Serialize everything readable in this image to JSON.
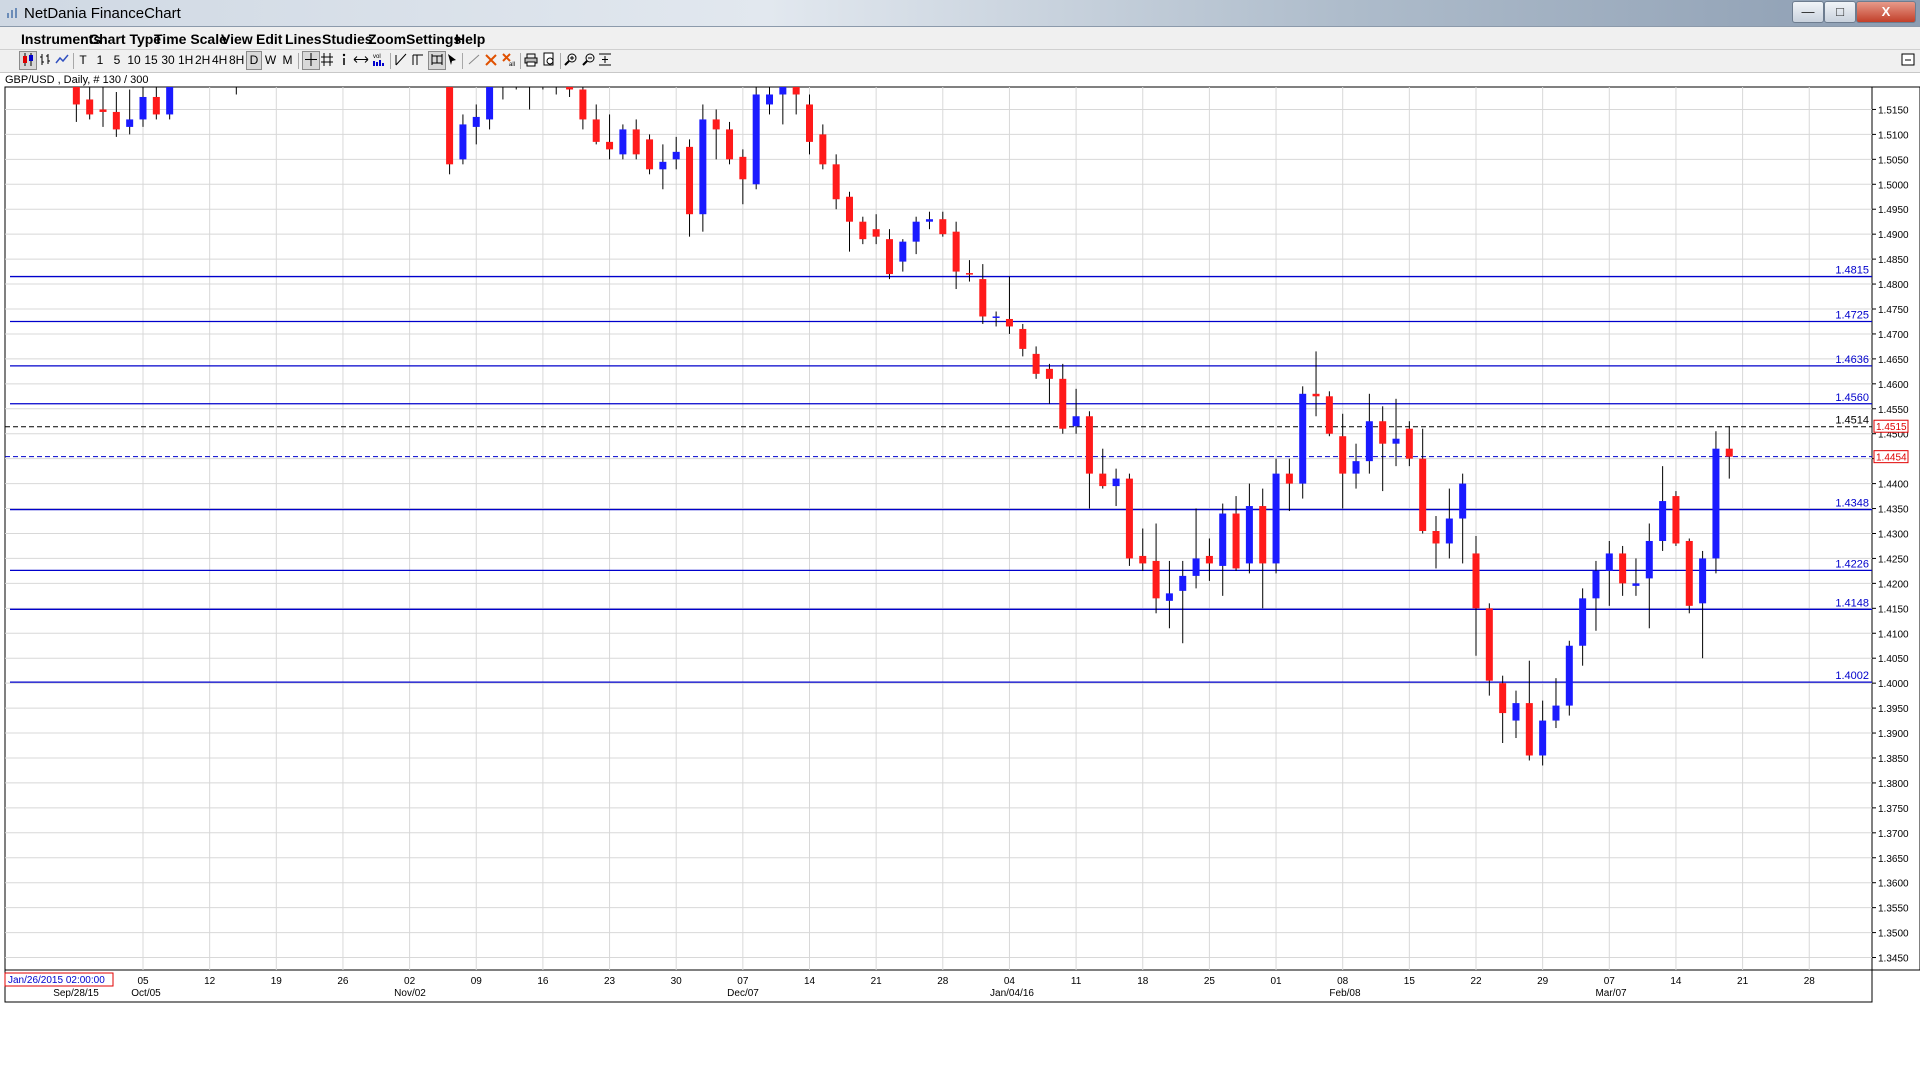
{
  "window": {
    "title": "NetDania FinanceChart",
    "minimize_glyph": "—",
    "maximize_glyph": "□",
    "close_glyph": "X"
  },
  "menu": [
    "Instruments",
    "Chart Type",
    "Time Scale",
    "View",
    "Edit",
    "Lines",
    "Studies",
    "Zoom",
    "Settings",
    "Help"
  ],
  "toolbar": {
    "timeframes": [
      "T",
      "1",
      "5",
      "10",
      "15",
      "30",
      "1H",
      "2H",
      "4H",
      "8H",
      "D",
      "W",
      "M"
    ],
    "selected_timeframe": "D",
    "icons": [
      "candlestick-icon",
      "bars-icon",
      "line-icon",
      "crosshair-icon",
      "grid-icon",
      "info-icon",
      "pan-icon",
      "volume-icon",
      "trendline-icon",
      "fibonacci-icon",
      "channel-icon",
      "cursor-icon",
      "draw-line-icon",
      "delete-icon",
      "delete-all-icon",
      "print-icon",
      "print-preview-icon",
      "zoom-in-icon",
      "zoom-out-icon",
      "fit-icon"
    ]
  },
  "instrument_label": "GBP/USD , Daily, # 130 / 300",
  "chart_data": {
    "type": "candlestick",
    "instrument": "GBP/USD",
    "period": "Daily",
    "y_axis": {
      "side": "right",
      "range": [
        1.3425,
        1.5195
      ],
      "ticks": [
        "1.5150",
        "1.5100",
        "1.5050",
        "1.5000",
        "1.4950",
        "1.4900",
        "1.4850",
        "1.4800",
        "1.4750",
        "1.4700",
        "1.4650",
        "1.4600",
        "1.4550",
        "1.4500",
        "1.4450",
        "1.4400",
        "1.4350",
        "1.4300",
        "1.4250",
        "1.4200",
        "1.4150",
        "1.4100",
        "1.4050",
        "1.4000",
        "1.3950",
        "1.3900",
        "1.3850",
        "1.3800",
        "1.3750",
        "1.3700",
        "1.3650",
        "1.3600",
        "1.3550",
        "1.3500",
        "1.3450"
      ]
    },
    "x_axis": {
      "day_labels": [
        "05",
        "12",
        "19",
        "26",
        "02",
        "09",
        "16",
        "23",
        "30",
        "07",
        "14",
        "21",
        "28",
        "04",
        "11",
        "18",
        "25",
        "01",
        "08",
        "15",
        "22",
        "29",
        "07",
        "14",
        "21",
        "28"
      ],
      "period_labels": [
        "Sep/28/15",
        "Oct/05",
        "Nov/02",
        "Dec/07",
        "Jan/04/16",
        "Feb/08",
        "Mar/07"
      ],
      "cursor_date_label": "Jan/26/2015 02:00:00"
    },
    "horizontal_lines": [
      {
        "value": 1.4815,
        "label": "1.4815"
      },
      {
        "value": 1.4725,
        "label": "1.4725"
      },
      {
        "value": 1.4636,
        "label": "1.4636"
      },
      {
        "value": 1.456,
        "label": "1.4560"
      },
      {
        "value": 1.4348,
        "label": "1.4348"
      },
      {
        "value": 1.4226,
        "label": "1.4226"
      },
      {
        "value": 1.4148,
        "label": "1.4148"
      },
      {
        "value": 1.4002,
        "label": "1.4002"
      }
    ],
    "dashed_lines": [
      {
        "value": 1.4514,
        "label": "1.4514",
        "color": "#000000"
      },
      {
        "value": 1.4454,
        "label": "",
        "color": "#0000cc"
      }
    ],
    "price_tags": [
      {
        "value": 1.4515,
        "label": "1.4515",
        "color": "#e00000"
      },
      {
        "value": 1.4454,
        "label": "1.4454",
        "color": "#e00000"
      }
    ],
    "colors": {
      "up": "#1a1aff",
      "down": "#ff1a1a",
      "wick": "#000000",
      "hline": "#0000cc",
      "grid": "#d8d8d8"
    },
    "candles": [
      {
        "date": "2015-09-28",
        "o": 1.522,
        "h": 1.524,
        "l": 1.5125,
        "c": 1.516
      },
      {
        "date": "2015-09-29",
        "o": 1.517,
        "h": 1.5215,
        "l": 1.513,
        "c": 1.514
      },
      {
        "date": "2015-09-30",
        "o": 1.515,
        "h": 1.52,
        "l": 1.5115,
        "c": 1.5145
      },
      {
        "date": "2015-10-01",
        "o": 1.5145,
        "h": 1.5185,
        "l": 1.5095,
        "c": 1.511
      },
      {
        "date": "2015-10-02",
        "o": 1.5115,
        "h": 1.519,
        "l": 1.51,
        "c": 1.513
      },
      {
        "date": "2015-10-05",
        "o": 1.513,
        "h": 1.5225,
        "l": 1.5115,
        "c": 1.5175
      },
      {
        "date": "2015-10-06",
        "o": 1.5175,
        "h": 1.5215,
        "l": 1.513,
        "c": 1.514
      },
      {
        "date": "2015-10-07",
        "o": 1.514,
        "h": 1.525,
        "l": 1.513,
        "c": 1.524
      },
      {
        "date": "2015-10-14",
        "o": 1.525,
        "h": 1.528,
        "l": 1.518,
        "c": 1.526
      },
      {
        "date": "2015-11-04",
        "o": 1.525,
        "h": 1.529,
        "l": 1.52,
        "c": 1.521
      },
      {
        "date": "2015-11-05",
        "o": 1.521,
        "h": 1.523,
        "l": 1.502,
        "c": 1.504
      },
      {
        "date": "2015-11-06",
        "o": 1.505,
        "h": 1.514,
        "l": 1.504,
        "c": 1.512
      },
      {
        "date": "2015-11-09",
        "o": 1.5115,
        "h": 1.516,
        "l": 1.508,
        "c": 1.5135
      },
      {
        "date": "2015-11-10",
        "o": 1.513,
        "h": 1.523,
        "l": 1.511,
        "c": 1.521
      },
      {
        "date": "2015-11-11",
        "o": 1.521,
        "h": 1.5255,
        "l": 1.517,
        "c": 1.5225
      },
      {
        "date": "2015-11-12",
        "o": 1.5225,
        "h": 1.527,
        "l": 1.519,
        "c": 1.524
      },
      {
        "date": "2015-11-13",
        "o": 1.524,
        "h": 1.525,
        "l": 1.515,
        "c": 1.5225
      },
      {
        "date": "2015-11-16",
        "o": 1.5225,
        "h": 1.524,
        "l": 1.519,
        "c": 1.521
      },
      {
        "date": "2015-11-17",
        "o": 1.521,
        "h": 1.5245,
        "l": 1.518,
        "c": 1.523
      },
      {
        "date": "2015-11-18",
        "o": 1.523,
        "h": 1.527,
        "l": 1.5175,
        "c": 1.519
      },
      {
        "date": "2015-11-19",
        "o": 1.519,
        "h": 1.522,
        "l": 1.511,
        "c": 1.513
      },
      {
        "date": "2015-11-20",
        "o": 1.513,
        "h": 1.516,
        "l": 1.508,
        "c": 1.5085
      },
      {
        "date": "2015-11-23",
        "o": 1.5085,
        "h": 1.514,
        "l": 1.505,
        "c": 1.507
      },
      {
        "date": "2015-11-24",
        "o": 1.506,
        "h": 1.512,
        "l": 1.505,
        "c": 1.511
      },
      {
        "date": "2015-11-25",
        "o": 1.511,
        "h": 1.513,
        "l": 1.505,
        "c": 1.506
      },
      {
        "date": "2015-11-26",
        "o": 1.509,
        "h": 1.51,
        "l": 1.502,
        "c": 1.503
      },
      {
        "date": "2015-11-27",
        "o": 1.503,
        "h": 1.508,
        "l": 1.499,
        "c": 1.5045
      },
      {
        "date": "2015-11-30",
        "o": 1.505,
        "h": 1.5095,
        "l": 1.503,
        "c": 1.5065
      },
      {
        "date": "2015-12-01",
        "o": 1.5075,
        "h": 1.509,
        "l": 1.4895,
        "c": 1.494
      },
      {
        "date": "2015-12-02",
        "o": 1.494,
        "h": 1.516,
        "l": 1.4905,
        "c": 1.513
      },
      {
        "date": "2015-12-03",
        "o": 1.513,
        "h": 1.515,
        "l": 1.505,
        "c": 1.511
      },
      {
        "date": "2015-12-04",
        "o": 1.511,
        "h": 1.5125,
        "l": 1.504,
        "c": 1.505
      },
      {
        "date": "2015-12-07",
        "o": 1.5055,
        "h": 1.507,
        "l": 1.496,
        "c": 1.501
      },
      {
        "date": "2015-12-08",
        "o": 1.5,
        "h": 1.52,
        "l": 1.499,
        "c": 1.518
      },
      {
        "date": "2015-12-09",
        "o": 1.516,
        "h": 1.522,
        "l": 1.514,
        "c": 1.518
      },
      {
        "date": "2015-12-10",
        "o": 1.518,
        "h": 1.523,
        "l": 1.512,
        "c": 1.522
      },
      {
        "date": "2015-12-11",
        "o": 1.521,
        "h": 1.5225,
        "l": 1.514,
        "c": 1.518
      },
      {
        "date": "2015-12-14",
        "o": 1.516,
        "h": 1.518,
        "l": 1.506,
        "c": 1.5085
      },
      {
        "date": "2015-12-15",
        "o": 1.51,
        "h": 1.512,
        "l": 1.503,
        "c": 1.504
      },
      {
        "date": "2015-12-16",
        "o": 1.504,
        "h": 1.506,
        "l": 1.495,
        "c": 1.497
      },
      {
        "date": "2015-12-17",
        "o": 1.4975,
        "h": 1.4985,
        "l": 1.4865,
        "c": 1.4925
      },
      {
        "date": "2015-12-18",
        "o": 1.4925,
        "h": 1.4935,
        "l": 1.488,
        "c": 1.489
      },
      {
        "date": "2015-12-21",
        "o": 1.491,
        "h": 1.494,
        "l": 1.488,
        "c": 1.4895
      },
      {
        "date": "2015-12-22",
        "o": 1.489,
        "h": 1.491,
        "l": 1.481,
        "c": 1.482
      },
      {
        "date": "2015-12-23",
        "o": 1.4845,
        "h": 1.489,
        "l": 1.4825,
        "c": 1.4885
      },
      {
        "date": "2015-12-24",
        "o": 1.4885,
        "h": 1.4935,
        "l": 1.486,
        "c": 1.4925
      },
      {
        "date": "2015-12-25",
        "o": 1.4925,
        "h": 1.4945,
        "l": 1.491,
        "c": 1.493
      },
      {
        "date": "2015-12-28",
        "o": 1.493,
        "h": 1.4945,
        "l": 1.4895,
        "c": 1.49
      },
      {
        "date": "2015-12-29",
        "o": 1.4905,
        "h": 1.4925,
        "l": 1.479,
        "c": 1.4825
      },
      {
        "date": "2015-12-30",
        "o": 1.4822,
        "h": 1.4848,
        "l": 1.4805,
        "c": 1.482
      },
      {
        "date": "2015-12-31",
        "o": 1.481,
        "h": 1.484,
        "l": 1.472,
        "c": 1.4735
      },
      {
        "date": "2016-01-01",
        "o": 1.4735,
        "h": 1.4745,
        "l": 1.4715,
        "c": 1.4735
      },
      {
        "date": "2016-01-04",
        "o": 1.473,
        "h": 1.4815,
        "l": 1.47,
        "c": 1.4715
      },
      {
        "date": "2016-01-05",
        "o": 1.471,
        "h": 1.472,
        "l": 1.4655,
        "c": 1.467
      },
      {
        "date": "2016-01-06",
        "o": 1.466,
        "h": 1.4675,
        "l": 1.461,
        "c": 1.462
      },
      {
        "date": "2016-01-07",
        "o": 1.463,
        "h": 1.464,
        "l": 1.456,
        "c": 1.461
      },
      {
        "date": "2016-01-08",
        "o": 1.461,
        "h": 1.464,
        "l": 1.45,
        "c": 1.451
      },
      {
        "date": "2016-01-11",
        "o": 1.4515,
        "h": 1.459,
        "l": 1.45,
        "c": 1.4535
      },
      {
        "date": "2016-01-12",
        "o": 1.4535,
        "h": 1.4545,
        "l": 1.435,
        "c": 1.442
      },
      {
        "date": "2016-01-13",
        "o": 1.442,
        "h": 1.447,
        "l": 1.439,
        "c": 1.4395
      },
      {
        "date": "2016-01-14",
        "o": 1.4395,
        "h": 1.443,
        "l": 1.4355,
        "c": 1.441
      },
      {
        "date": "2016-01-15",
        "o": 1.441,
        "h": 1.442,
        "l": 1.4235,
        "c": 1.425
      },
      {
        "date": "2016-01-18",
        "o": 1.4255,
        "h": 1.431,
        "l": 1.4225,
        "c": 1.424
      },
      {
        "date": "2016-01-19",
        "o": 1.4245,
        "h": 1.432,
        "l": 1.414,
        "c": 1.417
      },
      {
        "date": "2016-01-20",
        "o": 1.4165,
        "h": 1.4245,
        "l": 1.411,
        "c": 1.418
      },
      {
        "date": "2016-01-21",
        "o": 1.4185,
        "h": 1.4245,
        "l": 1.408,
        "c": 1.4215
      },
      {
        "date": "2016-01-22",
        "o": 1.4215,
        "h": 1.435,
        "l": 1.419,
        "c": 1.425
      },
      {
        "date": "2016-01-25",
        "o": 1.4255,
        "h": 1.429,
        "l": 1.4205,
        "c": 1.424
      },
      {
        "date": "2016-01-26",
        "o": 1.4235,
        "h": 1.436,
        "l": 1.4175,
        "c": 1.434
      },
      {
        "date": "2016-01-27",
        "o": 1.434,
        "h": 1.4375,
        "l": 1.4225,
        "c": 1.423
      },
      {
        "date": "2016-01-28",
        "o": 1.424,
        "h": 1.44,
        "l": 1.422,
        "c": 1.4355
      },
      {
        "date": "2016-01-29",
        "o": 1.4355,
        "h": 1.439,
        "l": 1.415,
        "c": 1.424
      },
      {
        "date": "2016-02-01",
        "o": 1.424,
        "h": 1.445,
        "l": 1.422,
        "c": 1.442
      },
      {
        "date": "2016-02-02",
        "o": 1.442,
        "h": 1.445,
        "l": 1.4345,
        "c": 1.44
      },
      {
        "date": "2016-02-03",
        "o": 1.44,
        "h": 1.4595,
        "l": 1.437,
        "c": 1.458
      },
      {
        "date": "2016-02-04",
        "o": 1.458,
        "h": 1.4665,
        "l": 1.4535,
        "c": 1.4575
      },
      {
        "date": "2016-02-05",
        "o": 1.4575,
        "h": 1.4585,
        "l": 1.4495,
        "c": 1.45
      },
      {
        "date": "2016-02-08",
        "o": 1.4495,
        "h": 1.454,
        "l": 1.435,
        "c": 1.442
      },
      {
        "date": "2016-02-09",
        "o": 1.442,
        "h": 1.448,
        "l": 1.439,
        "c": 1.4445
      },
      {
        "date": "2016-02-10",
        "o": 1.4445,
        "h": 1.458,
        "l": 1.442,
        "c": 1.4525
      },
      {
        "date": "2016-02-11",
        "o": 1.4525,
        "h": 1.4555,
        "l": 1.4385,
        "c": 1.448
      },
      {
        "date": "2016-02-12",
        "o": 1.448,
        "h": 1.457,
        "l": 1.4435,
        "c": 1.449
      },
      {
        "date": "2016-02-15",
        "o": 1.451,
        "h": 1.4525,
        "l": 1.4435,
        "c": 1.445
      },
      {
        "date": "2016-02-16",
        "o": 1.445,
        "h": 1.451,
        "l": 1.43,
        "c": 1.4305
      },
      {
        "date": "2016-02-17",
        "o": 1.4305,
        "h": 1.4335,
        "l": 1.423,
        "c": 1.428
      },
      {
        "date": "2016-02-18",
        "o": 1.428,
        "h": 1.439,
        "l": 1.425,
        "c": 1.433
      },
      {
        "date": "2016-02-19",
        "o": 1.433,
        "h": 1.442,
        "l": 1.424,
        "c": 1.44
      },
      {
        "date": "2016-02-22",
        "o": 1.426,
        "h": 1.4295,
        "l": 1.4055,
        "c": 1.415
      },
      {
        "date": "2016-02-23",
        "o": 1.415,
        "h": 1.416,
        "l": 1.3975,
        "c": 1.4005
      },
      {
        "date": "2016-02-24",
        "o": 1.4,
        "h": 1.4015,
        "l": 1.388,
        "c": 1.394
      },
      {
        "date": "2016-02-25",
        "o": 1.3925,
        "h": 1.3985,
        "l": 1.389,
        "c": 1.396
      },
      {
        "date": "2016-02-26",
        "o": 1.396,
        "h": 1.4045,
        "l": 1.3845,
        "c": 1.3855
      },
      {
        "date": "2016-02-29",
        "o": 1.3855,
        "h": 1.3965,
        "l": 1.3835,
        "c": 1.3925
      },
      {
        "date": "2016-03-01",
        "o": 1.3925,
        "h": 1.401,
        "l": 1.391,
        "c": 1.3955
      },
      {
        "date": "2016-03-02",
        "o": 1.3955,
        "h": 1.4085,
        "l": 1.3935,
        "c": 1.4075
      },
      {
        "date": "2016-03-03",
        "o": 1.4075,
        "h": 1.419,
        "l": 1.4035,
        "c": 1.417
      },
      {
        "date": "2016-03-04",
        "o": 1.417,
        "h": 1.4245,
        "l": 1.4105,
        "c": 1.4225
      },
      {
        "date": "2016-03-07",
        "o": 1.4225,
        "h": 1.4285,
        "l": 1.4155,
        "c": 1.426
      },
      {
        "date": "2016-03-08",
        "o": 1.426,
        "h": 1.4275,
        "l": 1.4175,
        "c": 1.42
      },
      {
        "date": "2016-03-09",
        "o": 1.4195,
        "h": 1.425,
        "l": 1.4175,
        "c": 1.42
      },
      {
        "date": "2016-03-10",
        "o": 1.421,
        "h": 1.432,
        "l": 1.411,
        "c": 1.4285
      },
      {
        "date": "2016-03-11",
        "o": 1.4285,
        "h": 1.4435,
        "l": 1.4265,
        "c": 1.4365
      },
      {
        "date": "2016-03-14",
        "o": 1.4375,
        "h": 1.4385,
        "l": 1.4275,
        "c": 1.428
      },
      {
        "date": "2016-03-15",
        "o": 1.4285,
        "h": 1.429,
        "l": 1.414,
        "c": 1.4155
      },
      {
        "date": "2016-03-16",
        "o": 1.416,
        "h": 1.4265,
        "l": 1.405,
        "c": 1.425
      },
      {
        "date": "2016-03-17",
        "o": 1.425,
        "h": 1.4505,
        "l": 1.422,
        "c": 1.447
      },
      {
        "date": "2016-03-18",
        "o": 1.447,
        "h": 1.4515,
        "l": 1.441,
        "c": 1.4454
      }
    ]
  }
}
